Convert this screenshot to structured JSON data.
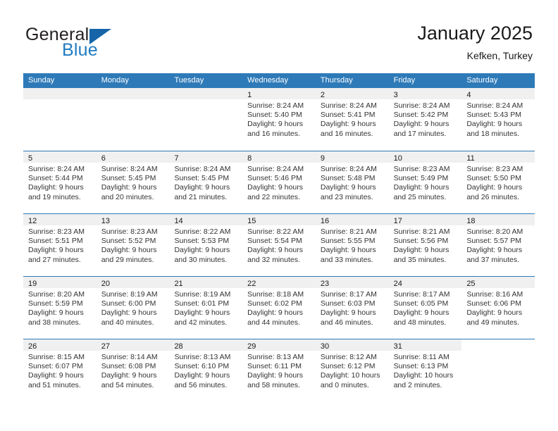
{
  "brand": {
    "name_part1": "General",
    "name_part2": "Blue",
    "flag_icon": "triangle-flag-icon"
  },
  "header": {
    "title": "January 2025",
    "location": "Kefken, Turkey"
  },
  "colors": {
    "header_row_bg": "#2e7ab8",
    "daynum_band_bg": "#f0f0f0",
    "brand_blue": "#1f7bc1",
    "flag_blue": "#1565a8",
    "text": "#333333"
  },
  "weekdays": [
    "Sunday",
    "Monday",
    "Tuesday",
    "Wednesday",
    "Thursday",
    "Friday",
    "Saturday"
  ],
  "weeks": [
    [
      {
        "type": "blank"
      },
      {
        "type": "blank"
      },
      {
        "type": "blank"
      },
      {
        "type": "day",
        "date": "1",
        "sunrise": "Sunrise: 8:24 AM",
        "sunset": "Sunset: 5:40 PM",
        "daylight1": "Daylight: 9 hours",
        "daylight2": "and 16 minutes."
      },
      {
        "type": "day",
        "date": "2",
        "sunrise": "Sunrise: 8:24 AM",
        "sunset": "Sunset: 5:41 PM",
        "daylight1": "Daylight: 9 hours",
        "daylight2": "and 16 minutes."
      },
      {
        "type": "day",
        "date": "3",
        "sunrise": "Sunrise: 8:24 AM",
        "sunset": "Sunset: 5:42 PM",
        "daylight1": "Daylight: 9 hours",
        "daylight2": "and 17 minutes."
      },
      {
        "type": "day",
        "date": "4",
        "sunrise": "Sunrise: 8:24 AM",
        "sunset": "Sunset: 5:43 PM",
        "daylight1": "Daylight: 9 hours",
        "daylight2": "and 18 minutes."
      }
    ],
    [
      {
        "type": "day",
        "date": "5",
        "sunrise": "Sunrise: 8:24 AM",
        "sunset": "Sunset: 5:44 PM",
        "daylight1": "Daylight: 9 hours",
        "daylight2": "and 19 minutes."
      },
      {
        "type": "day",
        "date": "6",
        "sunrise": "Sunrise: 8:24 AM",
        "sunset": "Sunset: 5:45 PM",
        "daylight1": "Daylight: 9 hours",
        "daylight2": "and 20 minutes."
      },
      {
        "type": "day",
        "date": "7",
        "sunrise": "Sunrise: 8:24 AM",
        "sunset": "Sunset: 5:45 PM",
        "daylight1": "Daylight: 9 hours",
        "daylight2": "and 21 minutes."
      },
      {
        "type": "day",
        "date": "8",
        "sunrise": "Sunrise: 8:24 AM",
        "sunset": "Sunset: 5:46 PM",
        "daylight1": "Daylight: 9 hours",
        "daylight2": "and 22 minutes."
      },
      {
        "type": "day",
        "date": "9",
        "sunrise": "Sunrise: 8:24 AM",
        "sunset": "Sunset: 5:48 PM",
        "daylight1": "Daylight: 9 hours",
        "daylight2": "and 23 minutes."
      },
      {
        "type": "day",
        "date": "10",
        "sunrise": "Sunrise: 8:23 AM",
        "sunset": "Sunset: 5:49 PM",
        "daylight1": "Daylight: 9 hours",
        "daylight2": "and 25 minutes."
      },
      {
        "type": "day",
        "date": "11",
        "sunrise": "Sunrise: 8:23 AM",
        "sunset": "Sunset: 5:50 PM",
        "daylight1": "Daylight: 9 hours",
        "daylight2": "and 26 minutes."
      }
    ],
    [
      {
        "type": "day",
        "date": "12",
        "sunrise": "Sunrise: 8:23 AM",
        "sunset": "Sunset: 5:51 PM",
        "daylight1": "Daylight: 9 hours",
        "daylight2": "and 27 minutes."
      },
      {
        "type": "day",
        "date": "13",
        "sunrise": "Sunrise: 8:23 AM",
        "sunset": "Sunset: 5:52 PM",
        "daylight1": "Daylight: 9 hours",
        "daylight2": "and 29 minutes."
      },
      {
        "type": "day",
        "date": "14",
        "sunrise": "Sunrise: 8:22 AM",
        "sunset": "Sunset: 5:53 PM",
        "daylight1": "Daylight: 9 hours",
        "daylight2": "and 30 minutes."
      },
      {
        "type": "day",
        "date": "15",
        "sunrise": "Sunrise: 8:22 AM",
        "sunset": "Sunset: 5:54 PM",
        "daylight1": "Daylight: 9 hours",
        "daylight2": "and 32 minutes."
      },
      {
        "type": "day",
        "date": "16",
        "sunrise": "Sunrise: 8:21 AM",
        "sunset": "Sunset: 5:55 PM",
        "daylight1": "Daylight: 9 hours",
        "daylight2": "and 33 minutes."
      },
      {
        "type": "day",
        "date": "17",
        "sunrise": "Sunrise: 8:21 AM",
        "sunset": "Sunset: 5:56 PM",
        "daylight1": "Daylight: 9 hours",
        "daylight2": "and 35 minutes."
      },
      {
        "type": "day",
        "date": "18",
        "sunrise": "Sunrise: 8:20 AM",
        "sunset": "Sunset: 5:57 PM",
        "daylight1": "Daylight: 9 hours",
        "daylight2": "and 37 minutes."
      }
    ],
    [
      {
        "type": "day",
        "date": "19",
        "sunrise": "Sunrise: 8:20 AM",
        "sunset": "Sunset: 5:59 PM",
        "daylight1": "Daylight: 9 hours",
        "daylight2": "and 38 minutes."
      },
      {
        "type": "day",
        "date": "20",
        "sunrise": "Sunrise: 8:19 AM",
        "sunset": "Sunset: 6:00 PM",
        "daylight1": "Daylight: 9 hours",
        "daylight2": "and 40 minutes."
      },
      {
        "type": "day",
        "date": "21",
        "sunrise": "Sunrise: 8:19 AM",
        "sunset": "Sunset: 6:01 PM",
        "daylight1": "Daylight: 9 hours",
        "daylight2": "and 42 minutes."
      },
      {
        "type": "day",
        "date": "22",
        "sunrise": "Sunrise: 8:18 AM",
        "sunset": "Sunset: 6:02 PM",
        "daylight1": "Daylight: 9 hours",
        "daylight2": "and 44 minutes."
      },
      {
        "type": "day",
        "date": "23",
        "sunrise": "Sunrise: 8:17 AM",
        "sunset": "Sunset: 6:03 PM",
        "daylight1": "Daylight: 9 hours",
        "daylight2": "and 46 minutes."
      },
      {
        "type": "day",
        "date": "24",
        "sunrise": "Sunrise: 8:17 AM",
        "sunset": "Sunset: 6:05 PM",
        "daylight1": "Daylight: 9 hours",
        "daylight2": "and 48 minutes."
      },
      {
        "type": "day",
        "date": "25",
        "sunrise": "Sunrise: 8:16 AM",
        "sunset": "Sunset: 6:06 PM",
        "daylight1": "Daylight: 9 hours",
        "daylight2": "and 49 minutes."
      }
    ],
    [
      {
        "type": "day",
        "date": "26",
        "sunrise": "Sunrise: 8:15 AM",
        "sunset": "Sunset: 6:07 PM",
        "daylight1": "Daylight: 9 hours",
        "daylight2": "and 51 minutes."
      },
      {
        "type": "day",
        "date": "27",
        "sunrise": "Sunrise: 8:14 AM",
        "sunset": "Sunset: 6:08 PM",
        "daylight1": "Daylight: 9 hours",
        "daylight2": "and 54 minutes."
      },
      {
        "type": "day",
        "date": "28",
        "sunrise": "Sunrise: 8:13 AM",
        "sunset": "Sunset: 6:10 PM",
        "daylight1": "Daylight: 9 hours",
        "daylight2": "and 56 minutes."
      },
      {
        "type": "day",
        "date": "29",
        "sunrise": "Sunrise: 8:13 AM",
        "sunset": "Sunset: 6:11 PM",
        "daylight1": "Daylight: 9 hours",
        "daylight2": "and 58 minutes."
      },
      {
        "type": "day",
        "date": "30",
        "sunrise": "Sunrise: 8:12 AM",
        "sunset": "Sunset: 6:12 PM",
        "daylight1": "Daylight: 10 hours",
        "daylight2": "and 0 minutes."
      },
      {
        "type": "day",
        "date": "31",
        "sunrise": "Sunrise: 8:11 AM",
        "sunset": "Sunset: 6:13 PM",
        "daylight1": "Daylight: 10 hours",
        "daylight2": "and 2 minutes."
      },
      {
        "type": "void"
      }
    ]
  ]
}
